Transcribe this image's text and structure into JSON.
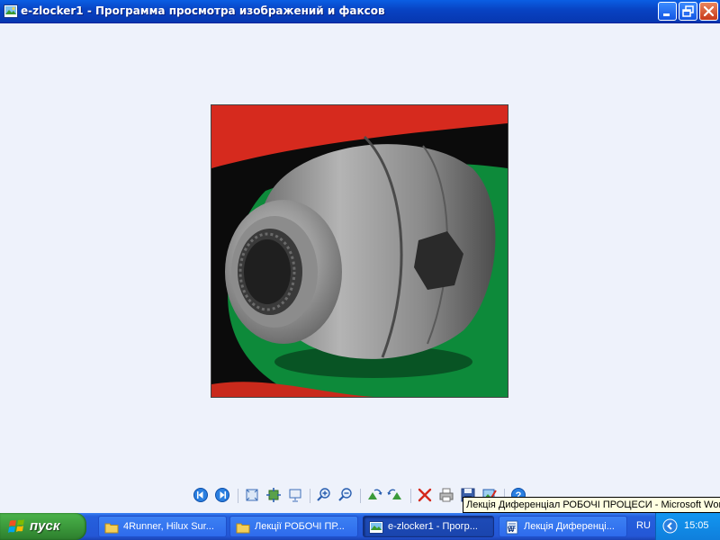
{
  "window": {
    "title": "e-zlocker1 - Программа просмотра изображений и факсов",
    "icon": "image-viewer-icon"
  },
  "image": {
    "subject": "differential-locker-photo"
  },
  "toolbar": {
    "buttons": [
      "previous-image-icon",
      "next-image-icon",
      "best-fit-icon",
      "actual-size-icon",
      "slideshow-icon",
      "zoom-in-icon",
      "zoom-out-icon",
      "rotate-clockwise-icon",
      "rotate-counterclockwise-icon",
      "delete-icon",
      "print-icon",
      "save-icon",
      "edit-icon",
      "help-icon"
    ]
  },
  "tooltip": {
    "text": "Лекція Диференціал РОБОЧІ ПРОЦЕСИ - Microsoft Word"
  },
  "taskbar": {
    "start_label": "пуск",
    "tasks": [
      {
        "label": "4Runner, Hilux Sur...",
        "icon": "folder-icon"
      },
      {
        "label": "Лекції РОБОЧІ ПР...",
        "icon": "folder-icon"
      },
      {
        "label": "e-zlocker1 - Прогр...",
        "icon": "image-viewer-icon"
      },
      {
        "label": "Лекція Диференці...",
        "icon": "word-document-icon"
      }
    ],
    "language": "RU",
    "clock": "15:05"
  },
  "colors": {
    "titlebar": "#0842c2",
    "taskbar": "#2457d6",
    "start_button": "#3c9a3c",
    "viewer_background": "#eef2fb",
    "tooltip_background": "#ffffe1"
  }
}
